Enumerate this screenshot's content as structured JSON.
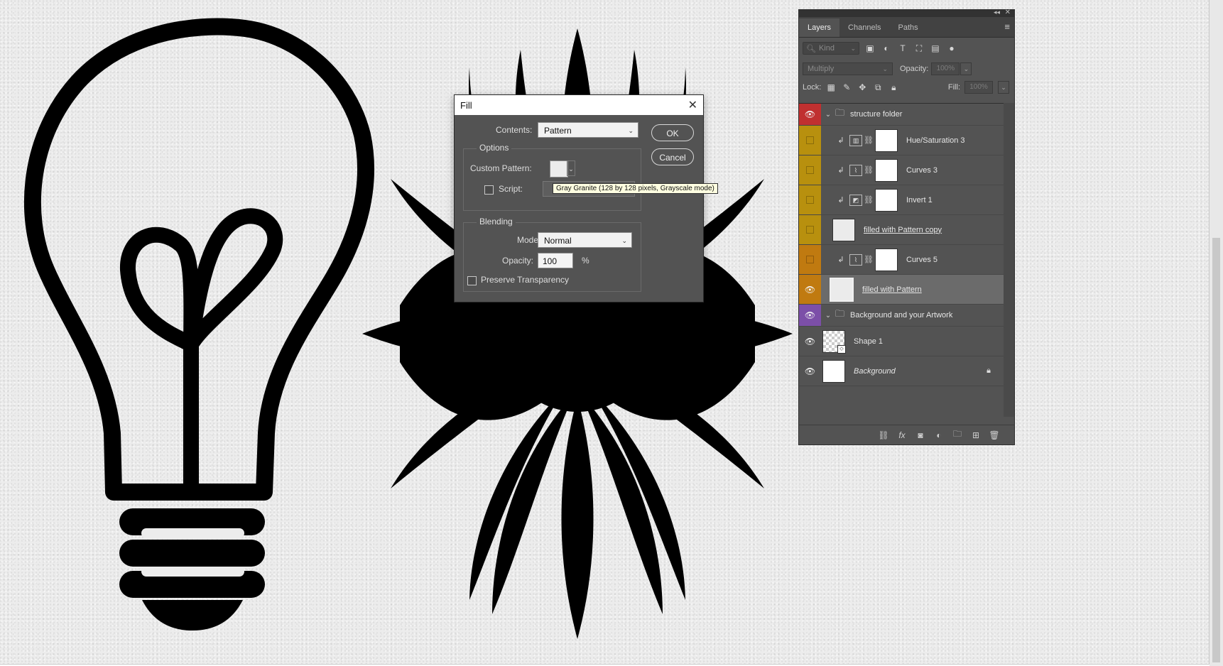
{
  "layers_panel": {
    "tabs": [
      "Layers",
      "Channels",
      "Paths"
    ],
    "filter_placeholder": "Kind",
    "blend_mode": "Multiply",
    "opacity_label": "Opacity:",
    "opacity_value": "100%",
    "lock_label": "Lock:",
    "fill_label": "Fill:",
    "fill_value": "100%",
    "layers": [
      {
        "name": "structure folder",
        "type": "group",
        "visible": true,
        "color": "#c03030"
      },
      {
        "name": "Hue/Saturation 3",
        "type": "adjustment",
        "visible": false,
        "color": "#b8900e",
        "adj_icon": "hue-saturation-icon"
      },
      {
        "name": "Curves 3",
        "type": "adjustment",
        "visible": false,
        "color": "#b8900e",
        "adj_icon": "curves-icon"
      },
      {
        "name": "Invert 1",
        "type": "adjustment",
        "visible": false,
        "color": "#b8900e",
        "adj_icon": "invert-icon"
      },
      {
        "name": "filled with Pattern copy",
        "type": "smart",
        "visible": false,
        "color": "#b8900e"
      },
      {
        "name": "Curves 5",
        "type": "adjustment",
        "visible": false,
        "color": "#c07a10",
        "adj_icon": "curves-icon"
      },
      {
        "name": "filled with Pattern",
        "type": "smart",
        "visible": true,
        "color": "#c07a10",
        "selected": true
      },
      {
        "name": "Background and your Artwork",
        "type": "group",
        "visible": true,
        "color": "#7c4fa8"
      },
      {
        "name": "Shape 1",
        "type": "shape",
        "visible": true,
        "color": ""
      },
      {
        "name": "Background",
        "type": "background",
        "visible": true,
        "color": "",
        "locked": true
      }
    ]
  },
  "fill_dialog": {
    "title": "Fill",
    "contents_label": "Contents:",
    "contents_value": "Pattern",
    "options_title": "Options",
    "custom_pattern_label": "Custom Pattern:",
    "script_label": "Script:",
    "blending_title": "Blending",
    "mode_label": "Mode:",
    "mode_value": "Normal",
    "opacity_label": "Opacity:",
    "opacity_value": "100",
    "percent": "%",
    "preserve_label": "Preserve Transparency",
    "ok_label": "OK",
    "cancel_label": "Cancel",
    "tooltip": "Gray Granite (128 by 128 pixels, Grayscale mode)"
  }
}
